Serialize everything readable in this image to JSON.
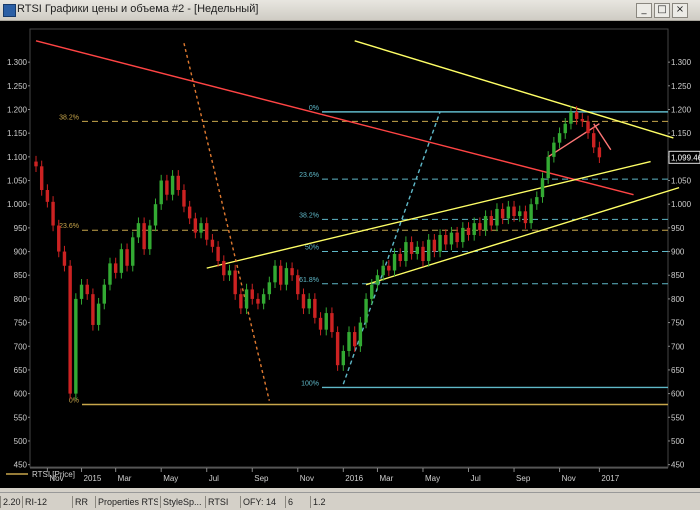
{
  "window": {
    "title": "RTSI Графики цены и объема #2 - [Недельный]",
    "buttons": [
      "_",
      "□",
      "×"
    ]
  },
  "status_segments": [
    "2.2014",
    "RI-12",
    "RR",
    "Properties RTSI",
    "StyleSp...",
    "RTSI",
    "OFY: 14",
    "6",
    "1.2"
  ],
  "chart_data": {
    "type": "candlestick",
    "series_label": "RTSI [Price]",
    "last_price_label": "1,099.46",
    "ylim": [
      445,
      1370
    ],
    "yticks": [
      450,
      500,
      550,
      600,
      650,
      700,
      750,
      800,
      850,
      900,
      950,
      1000,
      1050,
      1100,
      1150,
      1200,
      1250,
      1300
    ],
    "ytick_labels": [
      "450",
      "500",
      "550",
      "600",
      "650",
      "700",
      "750",
      "800",
      "850",
      "900",
      "950",
      "1.000",
      "1.050",
      "1.100",
      "1.150",
      "1.200",
      "1.250",
      "1.300"
    ],
    "x_range": [
      0,
      110
    ],
    "xtick_labels": [
      {
        "label": "Nov",
        "x": 2
      },
      {
        "label": "2015",
        "x": 8
      },
      {
        "label": "Mar",
        "x": 14
      },
      {
        "label": "May",
        "x": 22
      },
      {
        "label": "Jul",
        "x": 30
      },
      {
        "label": "Sep",
        "x": 38
      },
      {
        "label": "Nov",
        "x": 46
      },
      {
        "label": "2016",
        "x": 54
      },
      {
        "label": "Mar",
        "x": 60
      },
      {
        "label": "May",
        "x": 68
      },
      {
        "label": "Jul",
        "x": 76
      },
      {
        "label": "Sep",
        "x": 84
      },
      {
        "label": "Nov",
        "x": 92
      },
      {
        "label": "2017",
        "x": 99
      }
    ],
    "candles": [
      [
        0,
        1090,
        1080
      ],
      [
        1,
        1080,
        1030
      ],
      [
        2,
        1030,
        1005
      ],
      [
        3,
        1005,
        955
      ],
      [
        4,
        955,
        900
      ],
      [
        5,
        900,
        870
      ],
      [
        6,
        870,
        600
      ],
      [
        7,
        600,
        800
      ],
      [
        8,
        800,
        830
      ],
      [
        9,
        830,
        810
      ],
      [
        10,
        810,
        745
      ],
      [
        11,
        745,
        790
      ],
      [
        12,
        790,
        830
      ],
      [
        13,
        830,
        875
      ],
      [
        14,
        875,
        855
      ],
      [
        15,
        855,
        905
      ],
      [
        16,
        905,
        870
      ],
      [
        17,
        870,
        930
      ],
      [
        18,
        930,
        960
      ],
      [
        19,
        960,
        905
      ],
      [
        20,
        905,
        955
      ],
      [
        21,
        955,
        1000
      ],
      [
        22,
        1000,
        1050
      ],
      [
        23,
        1050,
        1020
      ],
      [
        24,
        1020,
        1060
      ],
      [
        25,
        1060,
        1030
      ],
      [
        26,
        1030,
        995
      ],
      [
        27,
        995,
        970
      ],
      [
        28,
        970,
        940
      ],
      [
        29,
        940,
        960
      ],
      [
        30,
        960,
        925
      ],
      [
        31,
        925,
        910
      ],
      [
        32,
        910,
        880
      ],
      [
        33,
        880,
        850
      ],
      [
        34,
        850,
        860
      ],
      [
        35,
        860,
        810
      ],
      [
        36,
        810,
        780
      ],
      [
        37,
        780,
        820
      ],
      [
        38,
        820,
        800
      ],
      [
        39,
        800,
        790
      ],
      [
        40,
        790,
        810
      ],
      [
        41,
        810,
        835
      ],
      [
        42,
        835,
        870
      ],
      [
        43,
        870,
        830
      ],
      [
        44,
        830,
        865
      ],
      [
        45,
        865,
        850
      ],
      [
        46,
        850,
        810
      ],
      [
        47,
        810,
        780
      ],
      [
        48,
        780,
        800
      ],
      [
        49,
        800,
        760
      ],
      [
        50,
        760,
        735
      ],
      [
        51,
        735,
        770
      ],
      [
        52,
        770,
        730
      ],
      [
        53,
        730,
        660
      ],
      [
        54,
        660,
        690
      ],
      [
        55,
        690,
        730
      ],
      [
        56,
        730,
        700
      ],
      [
        57,
        700,
        750
      ],
      [
        58,
        750,
        800
      ],
      [
        59,
        800,
        830
      ],
      [
        60,
        830,
        850
      ],
      [
        61,
        850,
        870
      ],
      [
        62,
        870,
        860
      ],
      [
        63,
        860,
        895
      ],
      [
        64,
        895,
        880
      ],
      [
        65,
        880,
        920
      ],
      [
        66,
        920,
        895
      ],
      [
        67,
        895,
        910
      ],
      [
        68,
        910,
        880
      ],
      [
        69,
        880,
        925
      ],
      [
        70,
        925,
        900
      ],
      [
        71,
        900,
        935
      ],
      [
        72,
        935,
        915
      ],
      [
        73,
        915,
        940
      ],
      [
        74,
        940,
        920
      ],
      [
        75,
        920,
        950
      ],
      [
        76,
        950,
        935
      ],
      [
        77,
        935,
        960
      ],
      [
        78,
        960,
        945
      ],
      [
        79,
        945,
        975
      ],
      [
        80,
        975,
        955
      ],
      [
        81,
        955,
        990
      ],
      [
        82,
        990,
        970
      ],
      [
        83,
        970,
        995
      ],
      [
        84,
        995,
        975
      ],
      [
        85,
        975,
        985
      ],
      [
        86,
        985,
        960
      ],
      [
        87,
        960,
        1000
      ],
      [
        88,
        1000,
        1015
      ],
      [
        89,
        1015,
        1055
      ],
      [
        90,
        1055,
        1100
      ],
      [
        91,
        1100,
        1130
      ],
      [
        92,
        1130,
        1150
      ],
      [
        93,
        1150,
        1170
      ],
      [
        94,
        1170,
        1195
      ],
      [
        95,
        1195,
        1180
      ],
      [
        96,
        1180,
        1175
      ],
      [
        97,
        1175,
        1150
      ],
      [
        98,
        1150,
        1120
      ],
      [
        99,
        1120,
        1099
      ]
    ],
    "fib_left": {
      "color": "#c8a64b",
      "levels": [
        {
          "label": "38.2%",
          "price": 1175
        },
        {
          "label": "23.6%",
          "price": 945
        },
        {
          "label": "0%",
          "price": 577
        }
      ]
    },
    "fib_right": {
      "color": "#5fb8c8",
      "levels": [
        {
          "label": "0%",
          "price": 1195
        },
        {
          "label": "23.6%",
          "price": 1053
        },
        {
          "label": "38.2%",
          "price": 968
        },
        {
          "label": "50%",
          "price": 900
        },
        {
          "label": "61.8%",
          "price": 832
        },
        {
          "label": "100%",
          "price": 613
        }
      ]
    },
    "trendlines": [
      {
        "color": "#ff4444",
        "x1": 0,
        "y1": 1345,
        "x2": 105,
        "y2": 1020,
        "dash": ""
      },
      {
        "color": "#ffff66",
        "x1": 56,
        "y1": 1345,
        "x2": 112,
        "y2": 1140,
        "dash": ""
      },
      {
        "color": "#ffff66",
        "x1": 30,
        "y1": 865,
        "x2": 108,
        "y2": 1090,
        "dash": ""
      },
      {
        "color": "#ffff66",
        "x1": 58,
        "y1": 830,
        "x2": 113,
        "y2": 1035,
        "dash": ""
      },
      {
        "color": "#e07a30",
        "x1": 26,
        "y1": 1340,
        "x2": 41,
        "y2": 585,
        "dash": "3,3"
      },
      {
        "color": "#5fb8c8",
        "x1": 54,
        "y1": 620,
        "x2": 71,
        "y2": 1195,
        "dash": "4,3"
      },
      {
        "color": "#ff7777",
        "x1": 90,
        "y1": 1100,
        "x2": 99,
        "y2": 1170,
        "dash": ""
      },
      {
        "color": "#ff7777",
        "x1": 98,
        "y1": 1170,
        "x2": 101,
        "y2": 1115,
        "dash": ""
      }
    ]
  }
}
